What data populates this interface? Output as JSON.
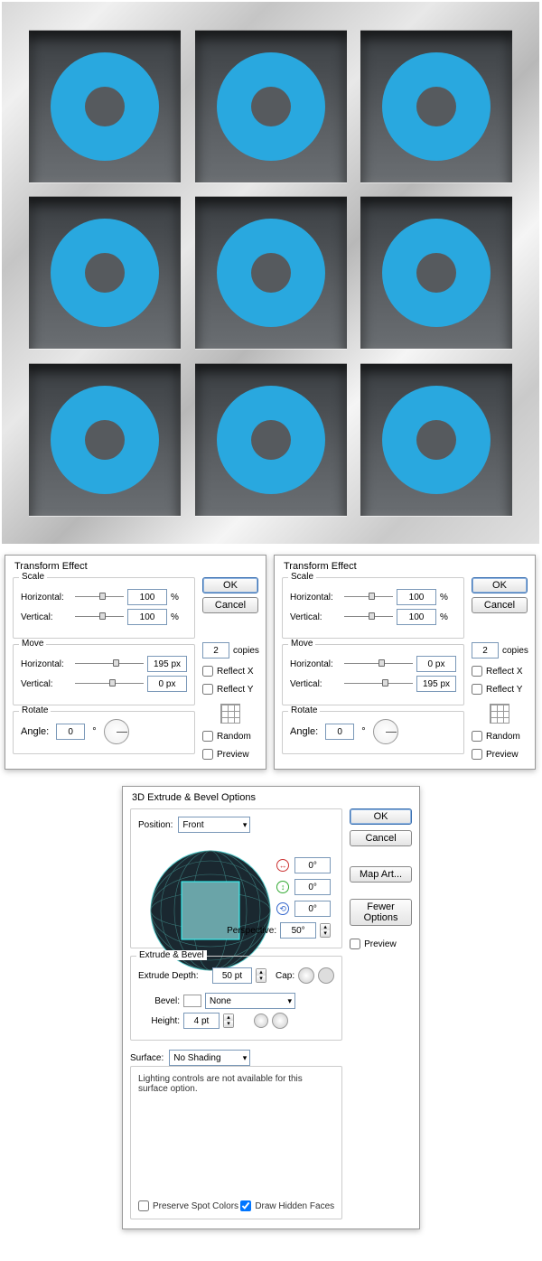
{
  "transform1": {
    "title": "Transform Effect",
    "scale_label": "Scale",
    "horizontal_label": "Horizontal:",
    "vertical_label": "Vertical:",
    "scale_h": "100",
    "scale_v": "100",
    "scale_unit": "%",
    "move_label": "Move",
    "move_h": "195 px",
    "move_v": "0 px",
    "rotate_label": "Rotate",
    "angle_label": "Angle:",
    "angle": "0",
    "deg": "°",
    "copies": "2",
    "copies_label": "copies",
    "ok": "OK",
    "cancel": "Cancel",
    "reflect_x": "Reflect X",
    "reflect_y": "Reflect Y",
    "random": "Random",
    "preview": "Preview"
  },
  "transform2": {
    "title": "Transform Effect",
    "scale_label": "Scale",
    "horizontal_label": "Horizontal:",
    "vertical_label": "Vertical:",
    "scale_h": "100",
    "scale_v": "100",
    "scale_unit": "%",
    "move_label": "Move",
    "move_h": "0 px",
    "move_v": "195 px",
    "rotate_label": "Rotate",
    "angle_label": "Angle:",
    "angle": "0",
    "deg": "°",
    "copies": "2",
    "copies_label": "copies",
    "ok": "OK",
    "cancel": "Cancel",
    "reflect_x": "Reflect X",
    "reflect_y": "Reflect Y",
    "random": "Random",
    "preview": "Preview"
  },
  "d3": {
    "title": "3D Extrude & Bevel Options",
    "position_label": "Position:",
    "position_value": "Front",
    "rx": "0°",
    "ry": "0°",
    "rz": "0°",
    "perspective_label": "Perspective:",
    "perspective": "50°",
    "extrude_label": "Extrude & Bevel",
    "depth_label": "Extrude Depth:",
    "depth": "50 pt",
    "cap_label": "Cap:",
    "bevel_label": "Bevel:",
    "bevel_value": "None",
    "height_label": "Height:",
    "height": "4 pt",
    "surface_label": "Surface:",
    "surface_value": "No Shading",
    "surface_note": "Lighting controls are not available for this surface option.",
    "preserve": "Preserve Spot Colors",
    "draw_hidden": "Draw Hidden Faces",
    "ok": "OK",
    "cancel": "Cancel",
    "map_art": "Map Art...",
    "fewer": "Fewer Options",
    "preview": "Preview"
  }
}
